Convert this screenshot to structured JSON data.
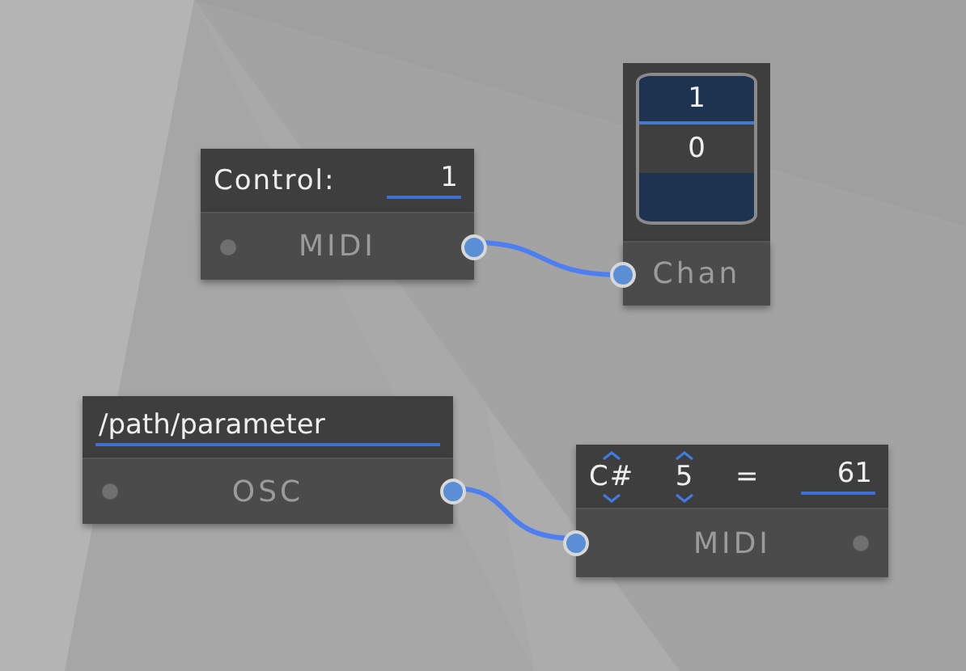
{
  "nodes": [
    {
      "kind": "control",
      "label": "Control:",
      "value": "1",
      "footer": "MIDI"
    },
    {
      "kind": "spinner",
      "items": [
        {
          "text": "1",
          "selected": false
        },
        {
          "text": "0",
          "selected": true
        }
      ],
      "footer": "Chan"
    },
    {
      "kind": "path",
      "value": "/path/parameter",
      "footer": "OSC"
    },
    {
      "kind": "note",
      "note": "C#",
      "octave": "5",
      "equals": "=",
      "value": "61",
      "footer": "MIDI"
    }
  ]
}
